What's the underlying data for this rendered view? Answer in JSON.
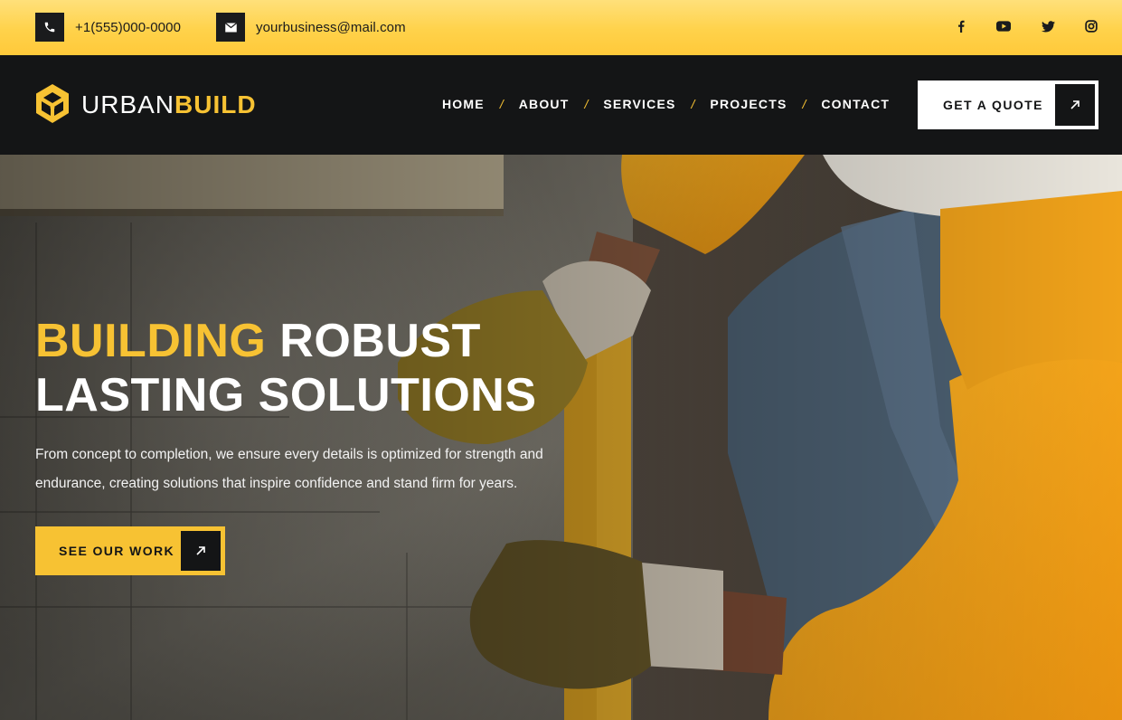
{
  "topbar": {
    "phone": "+1(555)000-0000",
    "email": "yourbusiness@mail.com",
    "icons": {
      "phone": "phone-icon",
      "email": "mail-icon"
    },
    "social": [
      "facebook-icon",
      "youtube-icon",
      "twitter-icon",
      "instagram-icon"
    ]
  },
  "brand": {
    "name_light": "URBAN",
    "name_bold": "BUILD",
    "logo_icon": "cube-logo-icon"
  },
  "nav": {
    "items": [
      "HOME",
      "ABOUT",
      "SERVICES",
      "PROJECTS",
      "CONTACT"
    ],
    "separator": "/"
  },
  "quote_button": {
    "label": "GET A QUOTE",
    "icon": "arrow-up-right-icon"
  },
  "hero": {
    "title_highlight": "BUILDING",
    "title_rest_line1": "ROBUST",
    "title_line2": "LASTING SOLUTIONS",
    "description": "From concept to completion, we ensure every details is optimized for strength and endurance, creating solutions that inspire confidence and stand firm for years.",
    "cta_label": "SEE OUR WORK",
    "cta_icon": "arrow-up-right-icon"
  },
  "colors": {
    "accent": "#f7c233",
    "dark": "#141516",
    "topbar": "#ffd24a"
  }
}
